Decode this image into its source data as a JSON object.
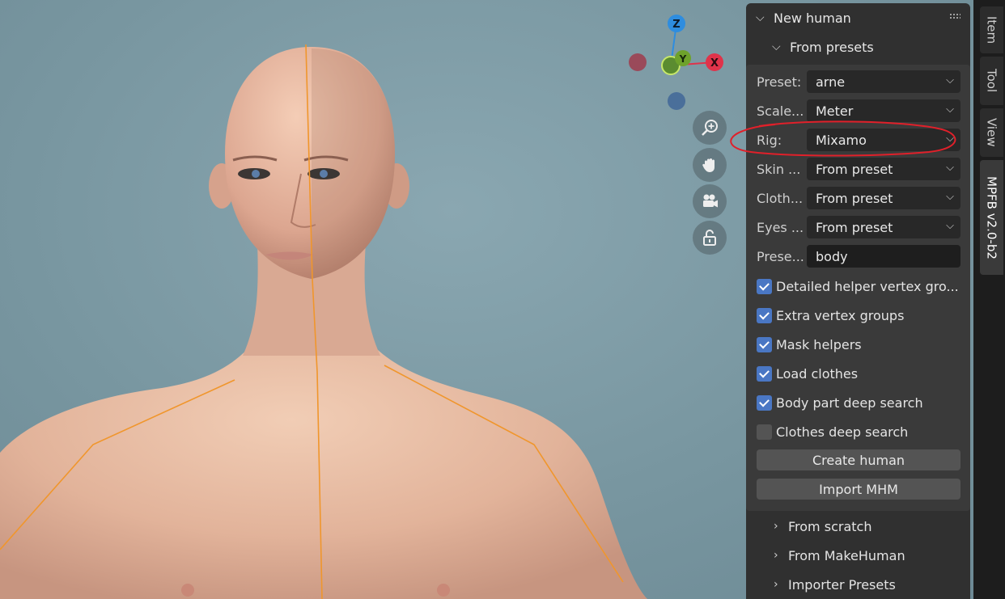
{
  "panel": {
    "title": "New human",
    "section": "From presets",
    "props": [
      {
        "label": "Preset:",
        "value": "arne"
      },
      {
        "label": "Scale...",
        "value": "Meter"
      },
      {
        "label": "Rig:",
        "value": "Mixamo"
      },
      {
        "label": "Skin ...",
        "value": "From preset"
      },
      {
        "label": "Cloth...",
        "value": "From preset"
      },
      {
        "label": "Eyes ...",
        "value": "From preset"
      },
      {
        "label": "Prese...",
        "value": "body"
      }
    ],
    "checkboxes": [
      {
        "label": "Detailed helper vertex gro...",
        "checked": true
      },
      {
        "label": "Extra vertex groups",
        "checked": true
      },
      {
        "label": "Mask helpers",
        "checked": true
      },
      {
        "label": "Load clothes",
        "checked": true
      },
      {
        "label": "Body part deep search",
        "checked": true
      },
      {
        "label": "Clothes deep search",
        "checked": false
      }
    ],
    "buttons": {
      "create": "Create human",
      "import": "Import MHM"
    },
    "collapsed": [
      "From scratch",
      "From MakeHuman",
      "Importer Presets"
    ]
  },
  "tabs": [
    "Item",
    "Tool",
    "View",
    "MPFB v2.0-b2"
  ],
  "gizmo": {
    "z": "Z",
    "y": "Y",
    "x": "X"
  },
  "icons": {
    "zoom": "zoom-in-icon",
    "pan": "hand-icon",
    "camera": "camera-icon",
    "lock": "lock-open-icon",
    "collapse": "chevron-down-icon",
    "expand": "chevron-right-icon",
    "caret": "dropdown-caret-icon",
    "grip": "grip-icon"
  },
  "colors": {
    "accent": "#4a77c4",
    "annotation": "#e0202a",
    "bone": "#f0962c",
    "x_axis": "#e0334a",
    "y_axis": "#6ea22b",
    "z_axis": "#2e8ddf"
  }
}
